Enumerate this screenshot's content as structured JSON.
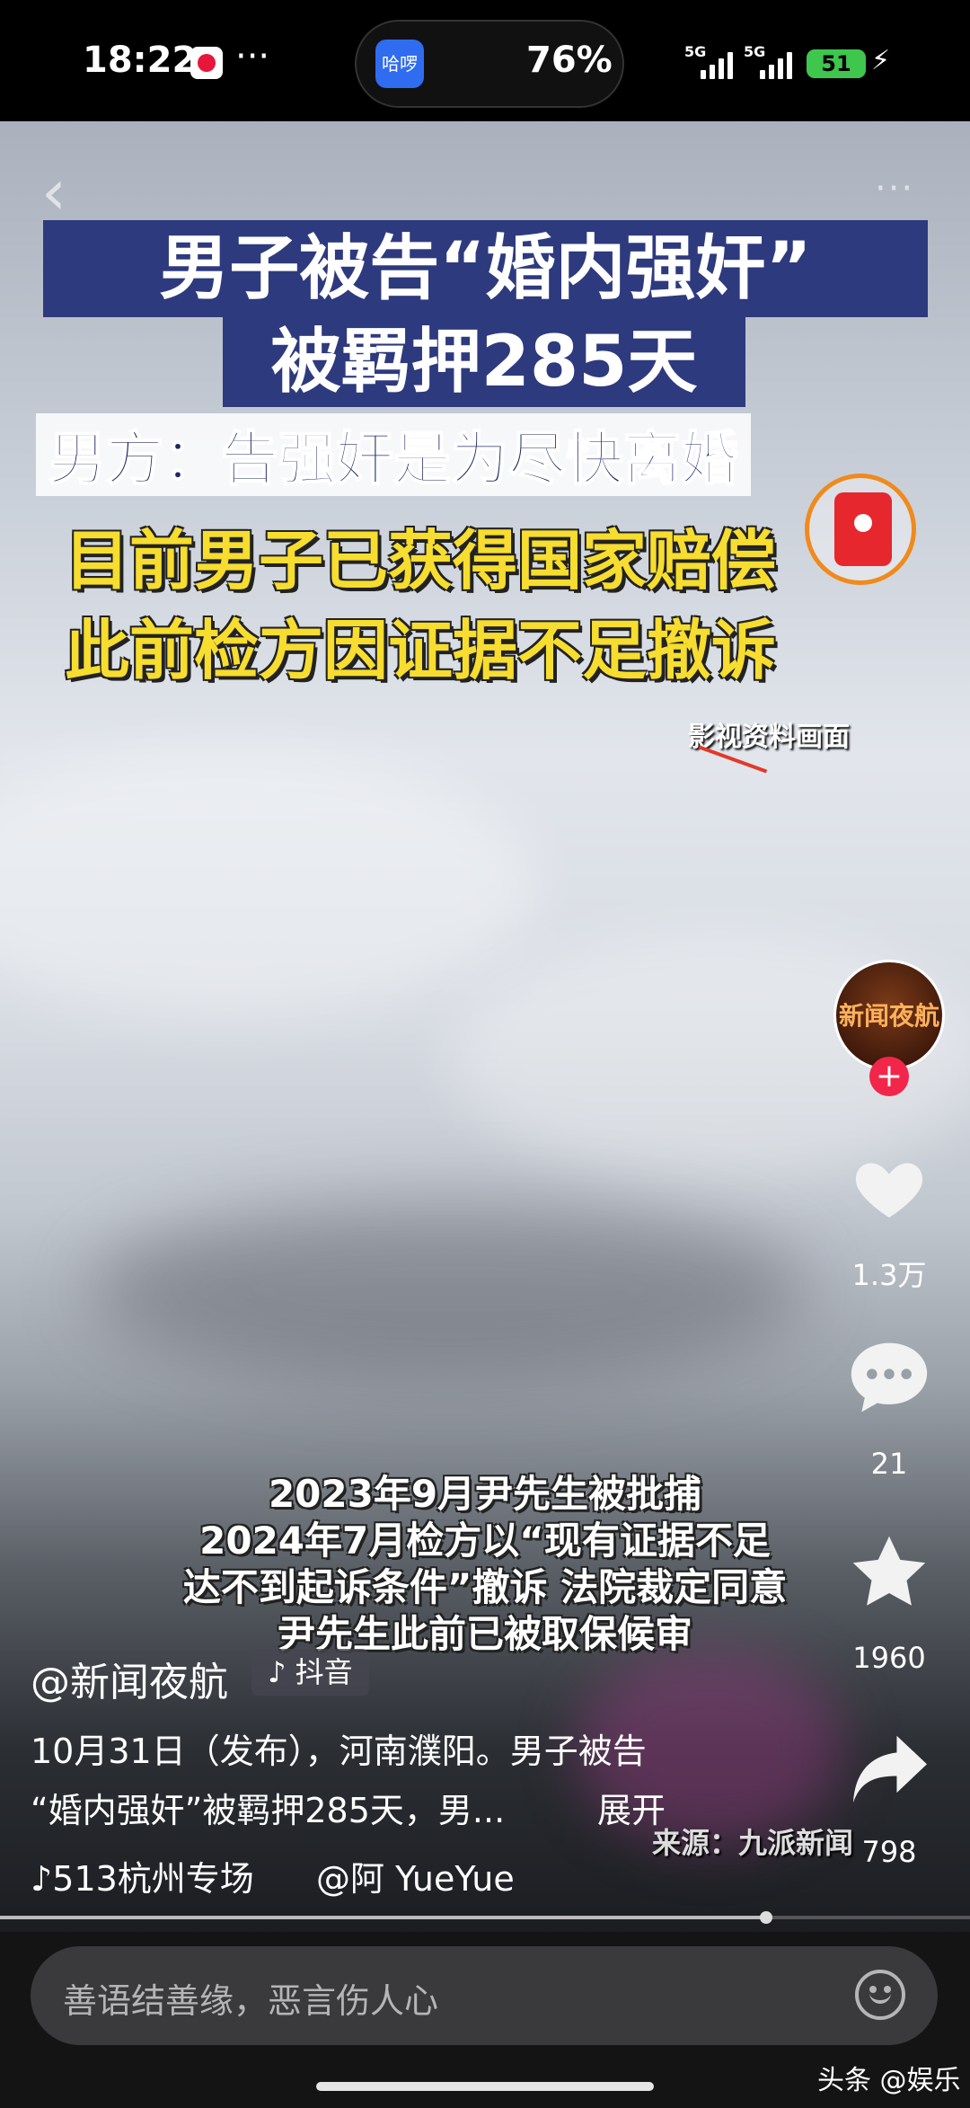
{
  "status_bar": {
    "time": "18:22",
    "more": "···",
    "app_badge": "哈啰",
    "battery_percent": "76%",
    "network_1": "5G",
    "network_2": "5G",
    "battery_level": "51"
  },
  "video": {
    "headline_line1": "男子被告“婚内强奸”",
    "headline_line2": "被羁押285天",
    "headline_line3": "男方：告强奸是为尽快离婚",
    "highlight_line1": "目前男子已获得国家赔偿",
    "highlight_line2": "此前检方因证据不足撤诉",
    "footage_label": "影视资料画面",
    "subtitles": [
      "2023年9月尹先生被批捕",
      "2024年7月检方以“现有证据不足",
      "达不到起诉条件”撤诉 法院裁定同意",
      "尹先生此前已被取保候审"
    ],
    "source": "来源：九派新闻"
  },
  "right_rail": {
    "avatar_text": "新闻夜航",
    "follow": "+",
    "likes": "1.3万",
    "comments": "21",
    "favorites": "1960",
    "shares": "798"
  },
  "post": {
    "author": "@新闻夜航",
    "platform": "抖音",
    "caption_line1": "10月31日（发布），河南濮阳。男子被告",
    "caption_line2": "“婚内强奸”被羁押285天，男...",
    "expand": "展开",
    "music": "513杭州专场",
    "mention": "@阿 YueYue"
  },
  "progress": {
    "value": 0.79
  },
  "comment_bar": {
    "placeholder": "善语结善缘，恶言伤人心"
  },
  "watermark": "头条 @娱乐"
}
